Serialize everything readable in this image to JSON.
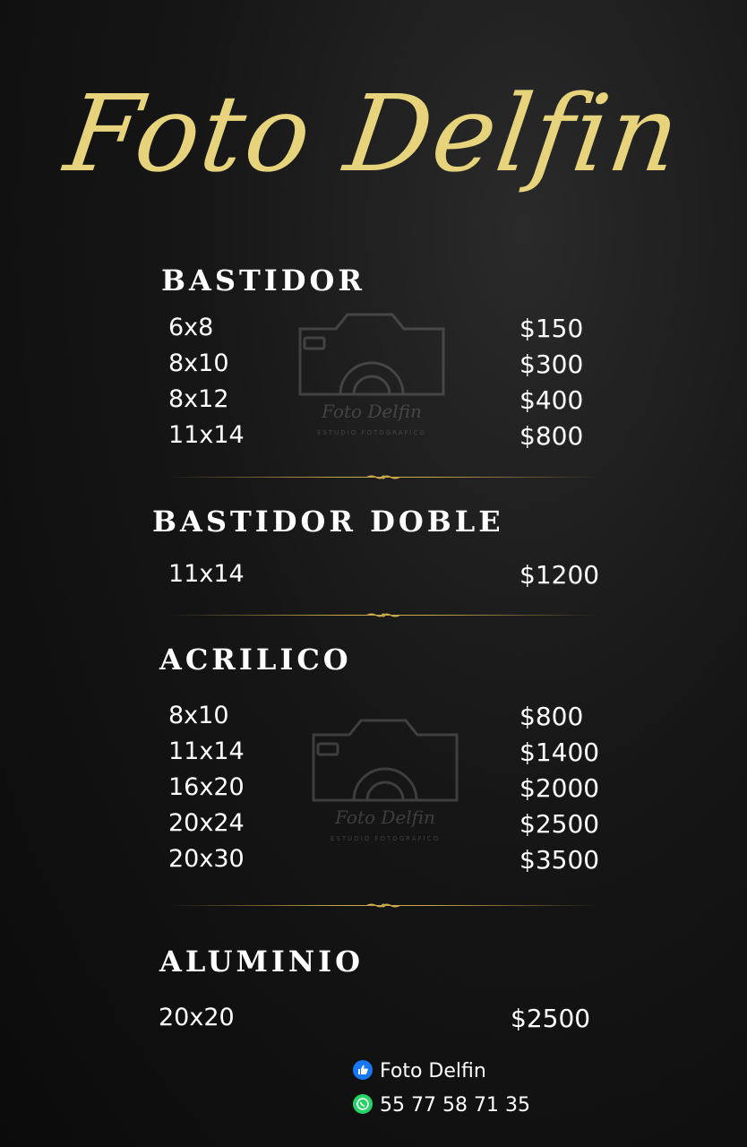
{
  "brand": {
    "name": "Foto Delfin",
    "color": "#e6d37c"
  },
  "watermark": {
    "name": "Foto Delfin",
    "subtitle": "ESTUDIO FOTOGRAFICO"
  },
  "sections": [
    {
      "title": "BASTIDOR",
      "items": [
        {
          "size": "6x8",
          "price": "$150"
        },
        {
          "size": "8x10",
          "price": "$300"
        },
        {
          "size": "8x12",
          "price": "$400"
        },
        {
          "size": "11x14",
          "price": "$800"
        }
      ]
    },
    {
      "title": "BASTIDOR DOBLE",
      "items": [
        {
          "size": "11x14",
          "price": "$1200"
        }
      ]
    },
    {
      "title": "ACRILICO",
      "items": [
        {
          "size": "8x10",
          "price": "$800"
        },
        {
          "size": "11x14",
          "price": "$1400"
        },
        {
          "size": "16x20",
          "price": "$2000"
        },
        {
          "size": "20x24",
          "price": "$2500"
        },
        {
          "size": "20x30",
          "price": "$3500"
        }
      ]
    },
    {
      "title": "ALUMINIO",
      "items": [
        {
          "size": "20x20",
          "price": "$2500"
        }
      ]
    }
  ],
  "contact": {
    "facebook": {
      "label": "Foto Delfin",
      "icon": "facebook-like-icon",
      "color": "#1877f2"
    },
    "whatsapp": {
      "label": "55 77 58 71 35",
      "icon": "whatsapp-icon",
      "color": "#25d366"
    }
  },
  "accent_gold": "#c9a84c"
}
